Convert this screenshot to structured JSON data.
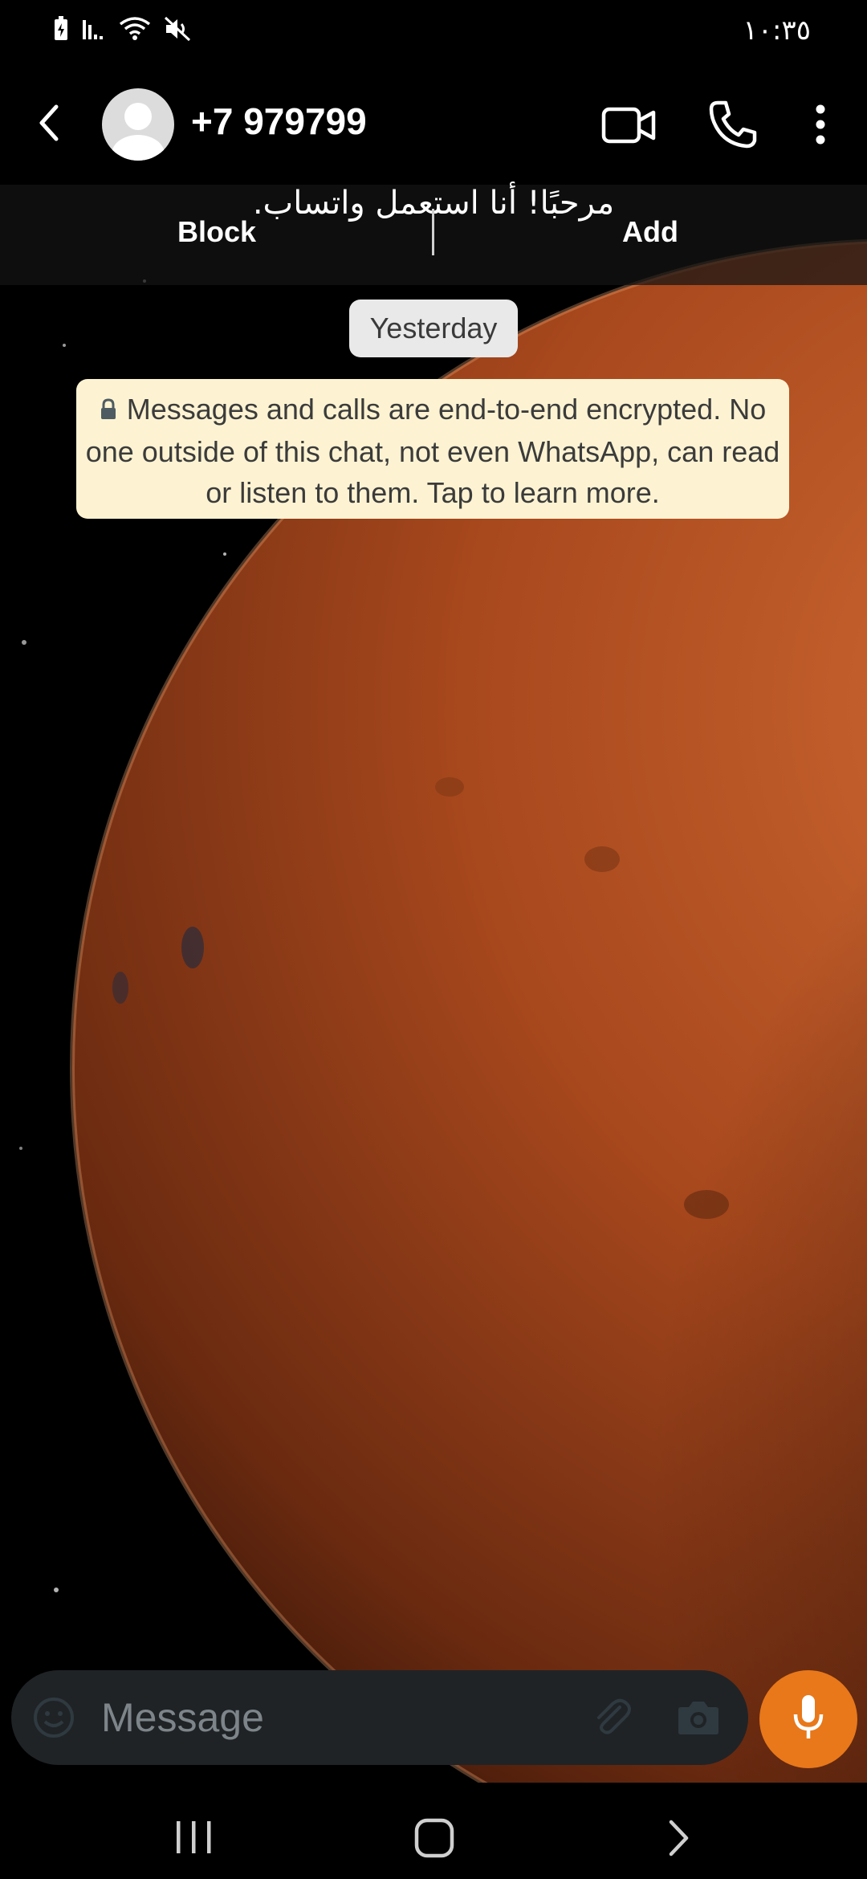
{
  "status_bar": {
    "time": "١٠:٣٥",
    "icons": [
      "battery-saver-icon",
      "signal-icon",
      "wifi-icon",
      "mute-icon"
    ]
  },
  "header": {
    "contact_name": "+7 979799",
    "icons": [
      "back-icon",
      "avatar-icon",
      "video-call-icon",
      "phone-icon",
      "more-vert-icon"
    ]
  },
  "banner": {
    "message": "مرحبًا! أنا استعمل واتساب.",
    "block_label": "Block",
    "add_label": "Add"
  },
  "chat": {
    "date_chip": "Yesterday",
    "encryption_notice": "Messages and calls are end-to-end encrypted. No one outside of this chat, not even WhatsApp, can read or listen to them. Tap to learn more.",
    "notice_icon": "lock-icon"
  },
  "composer": {
    "placeholder": "Message",
    "icons": [
      "emoji-icon",
      "attach-icon",
      "camera-icon",
      "mic-icon"
    ]
  },
  "colors": {
    "accent": "#E8781A",
    "notice_bg": "#FDF3D2",
    "composer_bg": "#1F2326",
    "date_chip_bg": "#E9E9E9"
  }
}
